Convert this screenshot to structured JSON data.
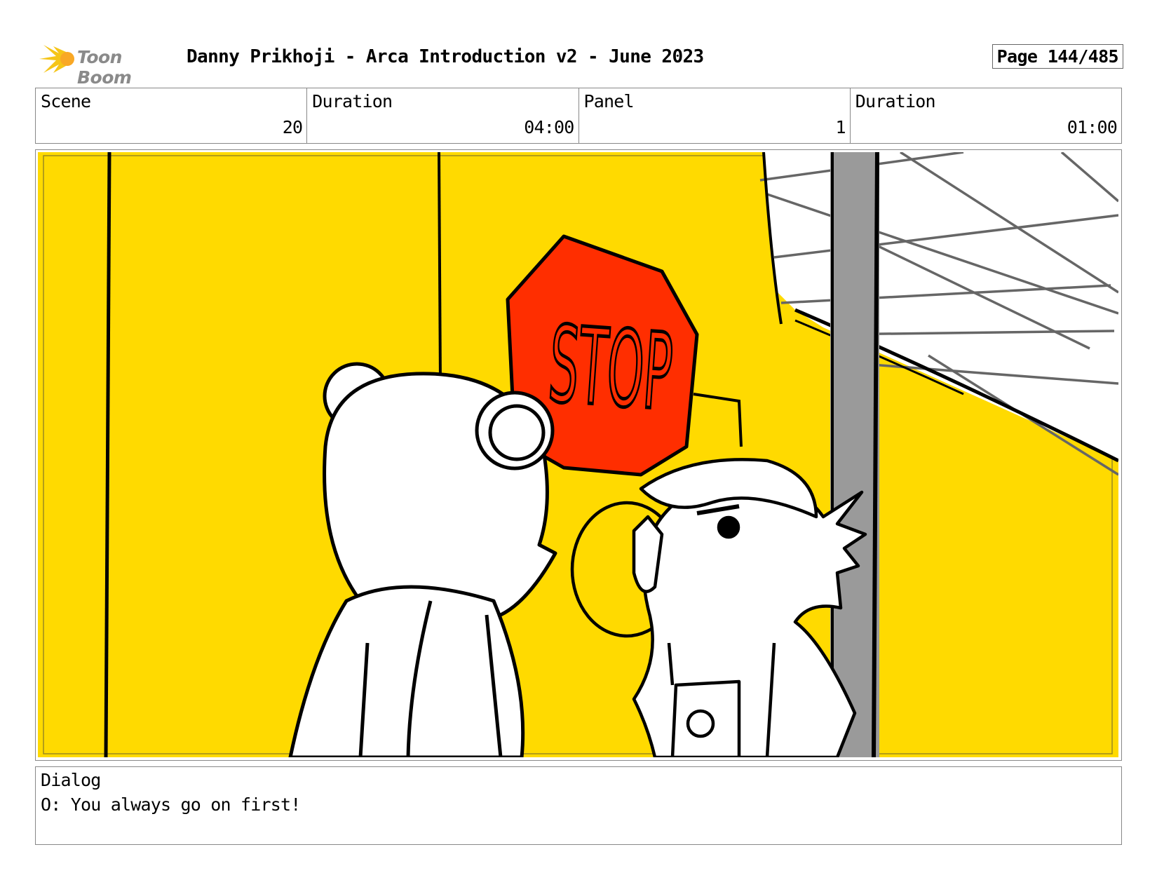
{
  "header": {
    "logo_text": "Toon Boom",
    "title": "Danny Prikhoji - Arca Introduction v2 - June 2023",
    "page_label": "Page 144/485"
  },
  "info": {
    "scene_label": "Scene",
    "scene_value": "20",
    "scene_duration_label": "Duration",
    "scene_duration_value": "04:00",
    "panel_label": "Panel",
    "panel_value": "1",
    "panel_duration_label": "Duration",
    "panel_duration_value": "01:00"
  },
  "panel_image": {
    "sign_text": "STOP",
    "colors": {
      "background": "#FFDA00",
      "sign": "#FF2E00",
      "pole": "#9A9A9A"
    }
  },
  "dialog": {
    "label": "Dialog",
    "text": "O: You always go on first!"
  }
}
